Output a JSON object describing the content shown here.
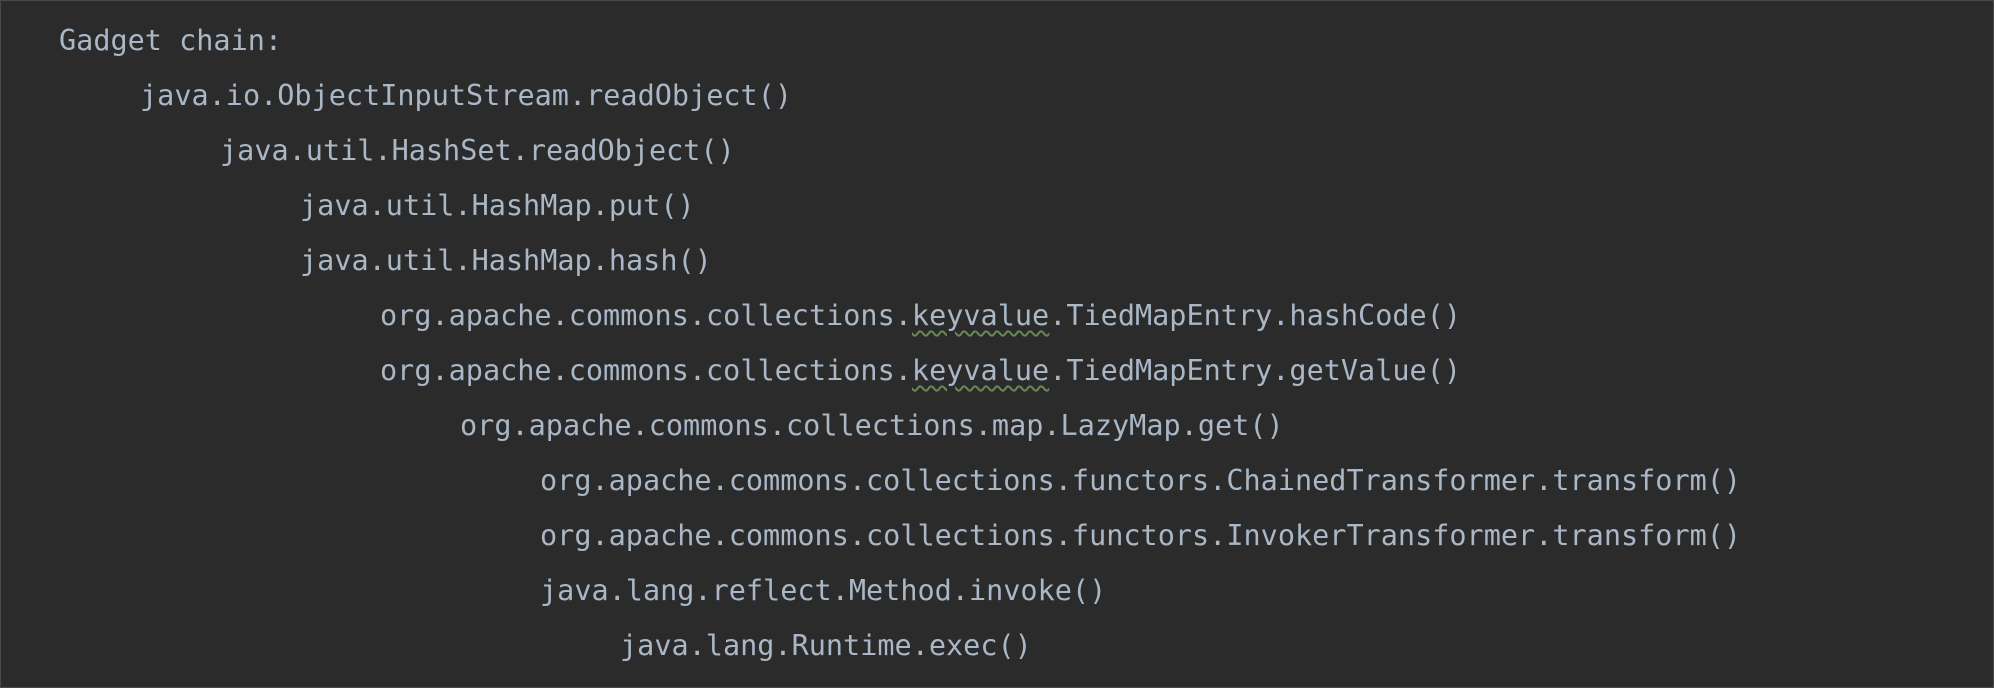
{
  "editor": {
    "header": "Gadget chain:",
    "lines": [
      "java.io.ObjectInputStream.readObject()",
      "java.util.HashSet.readObject()",
      "java.util.HashMap.put()",
      "java.util.HashMap.hash()",
      {
        "prefix": "org.apache.commons.collections.",
        "flagged": "keyvalue",
        "suffix": ".TiedMapEntry.hashCode()"
      },
      {
        "prefix": "org.apache.commons.collections.",
        "flagged": "keyvalue",
        "suffix": ".TiedMapEntry.getValue()"
      },
      "org.apache.commons.collections.map.LazyMap.get()",
      "org.apache.commons.collections.functors.ChainedTransformer.transform()",
      "org.apache.commons.collections.functors.InvokerTransformer.transform()",
      "java.lang.reflect.Method.invoke()",
      "java.lang.Runtime.exec()"
    ]
  },
  "colors": {
    "background": "#2b2b2b",
    "text": "#a9b7c6",
    "spellcheck_underline": "#6a8759"
  }
}
